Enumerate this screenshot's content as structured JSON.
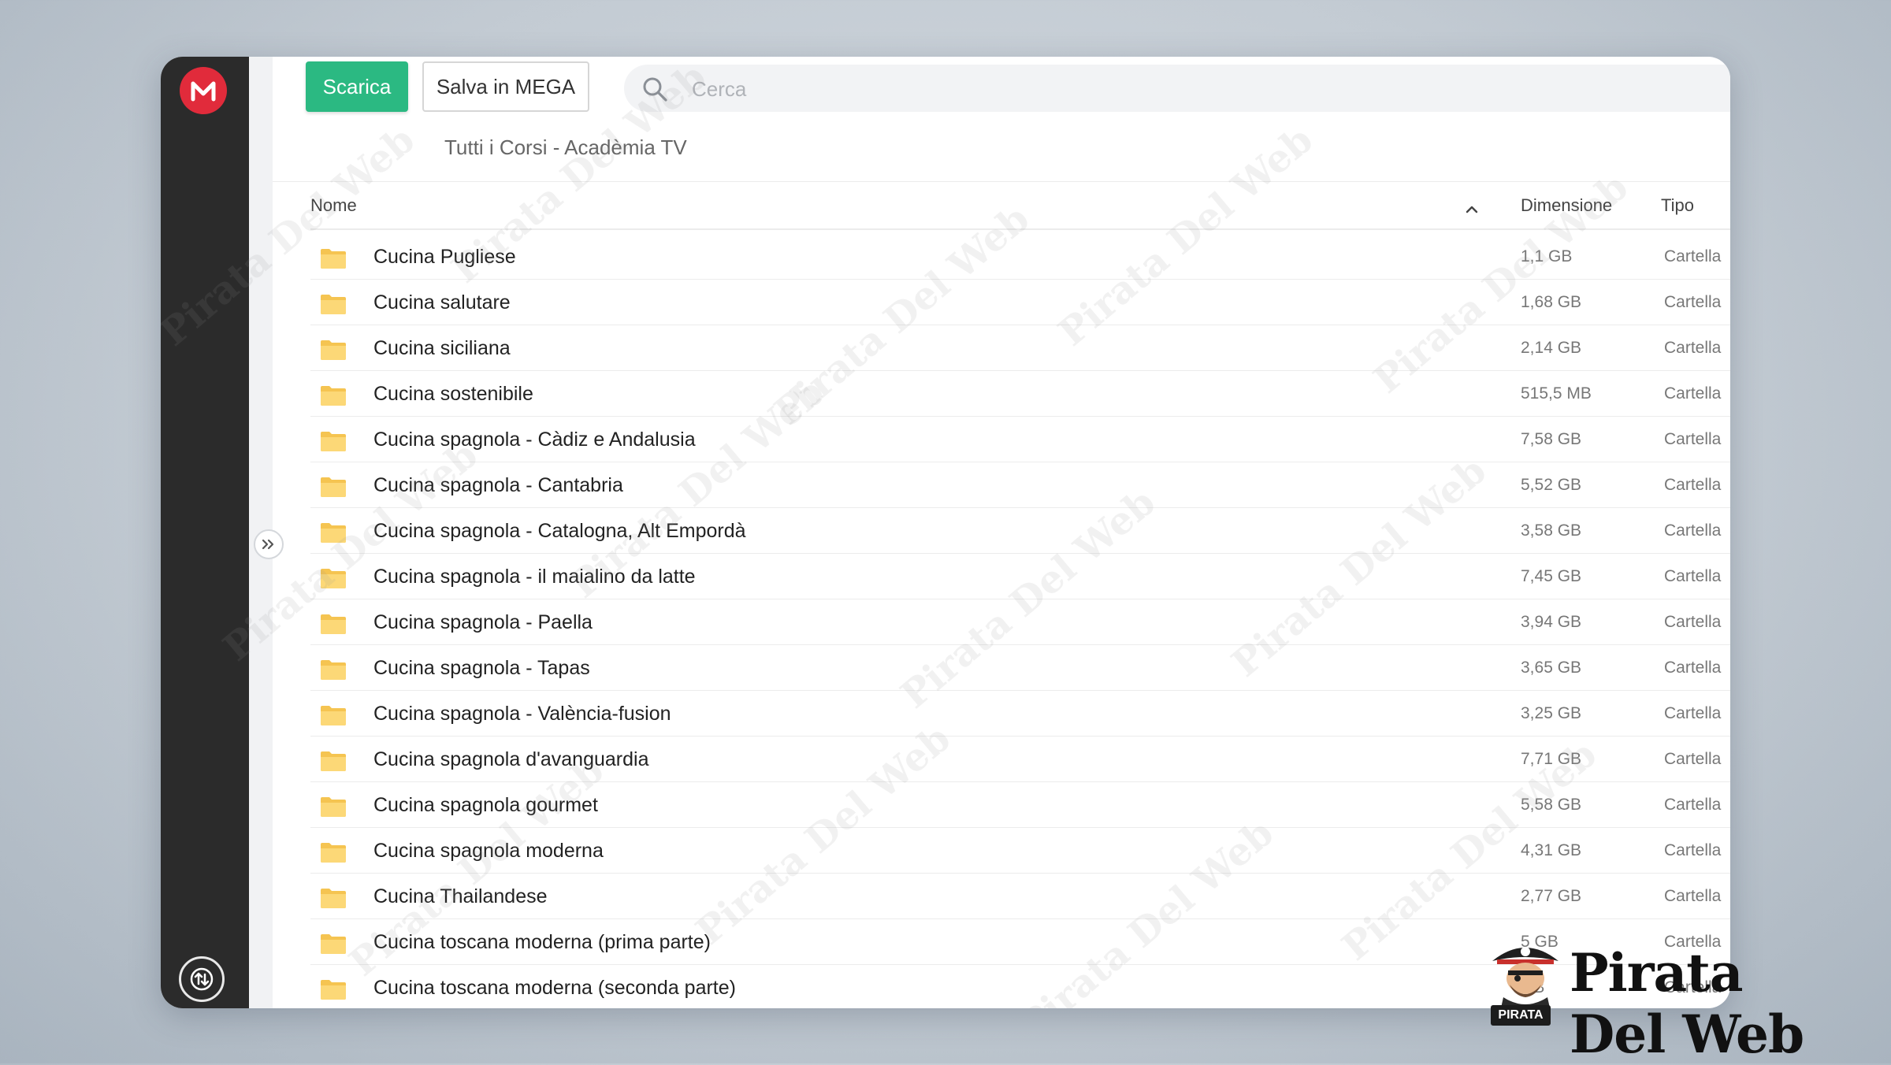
{
  "toolbar": {
    "download_label": "Scarica",
    "save_label": "Salva in MEGA"
  },
  "search": {
    "placeholder": "Cerca"
  },
  "breadcrumb": {
    "folder": "Tutti i Corsi - Acadèmia TV"
  },
  "table": {
    "columns": {
      "name": "Nome",
      "size": "Dimensione",
      "type": "Tipo"
    },
    "rows": [
      {
        "name": "Cucina Pugliese",
        "size": "1,1 GB",
        "type": "Cartella"
      },
      {
        "name": "Cucina salutare",
        "size": "1,68 GB",
        "type": "Cartella"
      },
      {
        "name": "Cucina siciliana",
        "size": "2,14 GB",
        "type": "Cartella"
      },
      {
        "name": "Cucina sostenibile",
        "size": "515,5 MB",
        "type": "Cartella"
      },
      {
        "name": "Cucina spagnola - Càdiz e Andalusia",
        "size": "7,58 GB",
        "type": "Cartella"
      },
      {
        "name": "Cucina spagnola - Cantabria",
        "size": "5,52 GB",
        "type": "Cartella"
      },
      {
        "name": "Cucina spagnola - Catalogna, Alt Empordà",
        "size": "3,58 GB",
        "type": "Cartella"
      },
      {
        "name": "Cucina spagnola - il maialino da latte",
        "size": "7,45 GB",
        "type": "Cartella"
      },
      {
        "name": "Cucina spagnola - Paella",
        "size": "3,94 GB",
        "type": "Cartella"
      },
      {
        "name": "Cucina spagnola - Tapas",
        "size": "3,65 GB",
        "type": "Cartella"
      },
      {
        "name": "Cucina spagnola - València-fusion",
        "size": "3,25 GB",
        "type": "Cartella"
      },
      {
        "name": "Cucina spagnola d'avanguardia",
        "size": "7,71 GB",
        "type": "Cartella"
      },
      {
        "name": "Cucina spagnola gourmet",
        "size": "5,58 GB",
        "type": "Cartella"
      },
      {
        "name": "Cucina spagnola moderna",
        "size": "4,31 GB",
        "type": "Cartella"
      },
      {
        "name": "Cucina Thailandese",
        "size": "2,77 GB",
        "type": "Cartella"
      },
      {
        "name": "Cucina toscana moderna (prima parte)",
        "size": "5 GB",
        "type": "Cartella"
      },
      {
        "name": "Cucina toscana moderna (seconda parte)",
        "size": "GB",
        "type": "Cartella"
      }
    ]
  },
  "watermark": {
    "brand": "Pirata Del Web",
    "badge": "PIRATA"
  },
  "colors": {
    "download_button": "#2bb982",
    "logo": "#e12b3b",
    "sidebar": "#2b2b2b",
    "folder": "#f5c451"
  }
}
